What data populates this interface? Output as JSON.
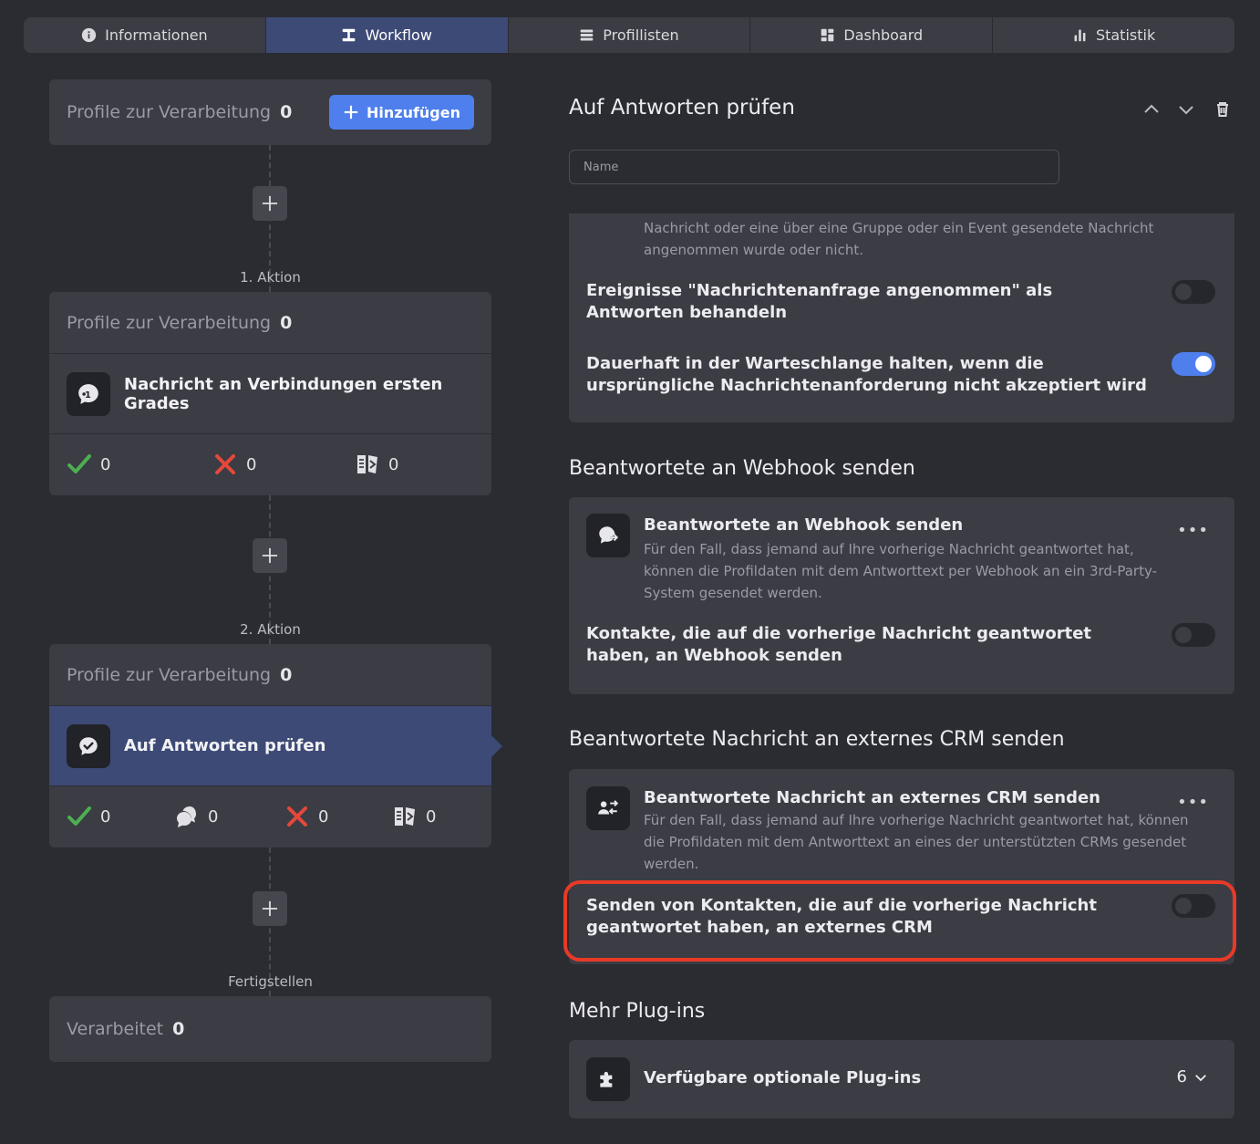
{
  "tabs": [
    {
      "label": "Informationen",
      "icon": "info-icon"
    },
    {
      "label": "Workflow",
      "icon": "workflow-icon",
      "active": true
    },
    {
      "label": "Profillisten",
      "icon": "list-icon"
    },
    {
      "label": "Dashboard",
      "icon": "dashboard-icon"
    },
    {
      "label": "Statistik",
      "icon": "statistics-icon"
    }
  ],
  "workflow": {
    "start": {
      "label": "Profile zur Verarbeitung",
      "count": "0",
      "add_button": "Hinzufügen"
    },
    "steps": [
      {
        "step_label": "1. Aktion",
        "queue_label": "Profile zur Verarbeitung",
        "queue_count": "0",
        "action_title": "Nachricht an Verbindungen ersten Grades",
        "stats": {
          "success": "0",
          "failed": "0",
          "skipped": "0"
        }
      },
      {
        "step_label": "2. Aktion",
        "queue_label": "Profile zur Verarbeitung",
        "queue_count": "0",
        "action_title": "Auf Antworten prüfen",
        "stats": {
          "success": "0",
          "replied": "0",
          "failed": "0",
          "skipped": "0"
        }
      }
    ],
    "finish": {
      "step_label": "Fertigstellen",
      "label": "Verarbeitet",
      "count": "0"
    }
  },
  "detail": {
    "title": "Auf Antworten prüfen",
    "name_placeholder": "Name",
    "partial_desc": "Nachricht oder eine über eine Gruppe oder ein Event gesendete Nachricht angenommen wurde oder nicht.",
    "settings": [
      {
        "text": "Ereignisse \"Nachrichtenanfrage angenommen\" als Antworten behandeln",
        "enabled": false
      },
      {
        "text": "Dauerhaft in der Warteschlange halten, wenn die ursprüngliche Nachrichtenanforderung nicht akzeptiert wird",
        "enabled": true
      }
    ],
    "webhook": {
      "section_title": "Beantwortete an Webhook senden",
      "plugin_title": "Beantwortete an Webhook senden",
      "plugin_desc": "Für den Fall, dass jemand auf Ihre vorherige Nachricht geantwortet hat, können die Profildaten mit dem Antworttext per Webhook an ein 3rd-Party-System gesendet werden.",
      "setting_text": "Kontakte, die auf die vorherige Nachricht geantwortet haben, an Webhook senden",
      "enabled": false
    },
    "crm": {
      "section_title": "Beantwortete Nachricht an externes CRM senden",
      "plugin_title": "Beantwortete Nachricht an externes CRM senden",
      "plugin_desc": "Für den Fall, dass jemand auf Ihre vorherige Nachricht geantwortet hat, können die Profildaten mit dem Antworttext an eines der unterstützten CRMs gesendet werden.",
      "setting_text": "Senden von Kontakten, die auf die vorherige Nachricht geantwortet haben, an externes CRM",
      "enabled": false
    },
    "more_plugins": {
      "section_title": "Mehr Plug-ins",
      "label": "Verfügbare optionale Plug-ins",
      "count": "6"
    }
  },
  "colors": {
    "accent": "#4e7fec",
    "highlight": "#e83a26",
    "success": "#4caf50",
    "failed": "#e5483b"
  }
}
